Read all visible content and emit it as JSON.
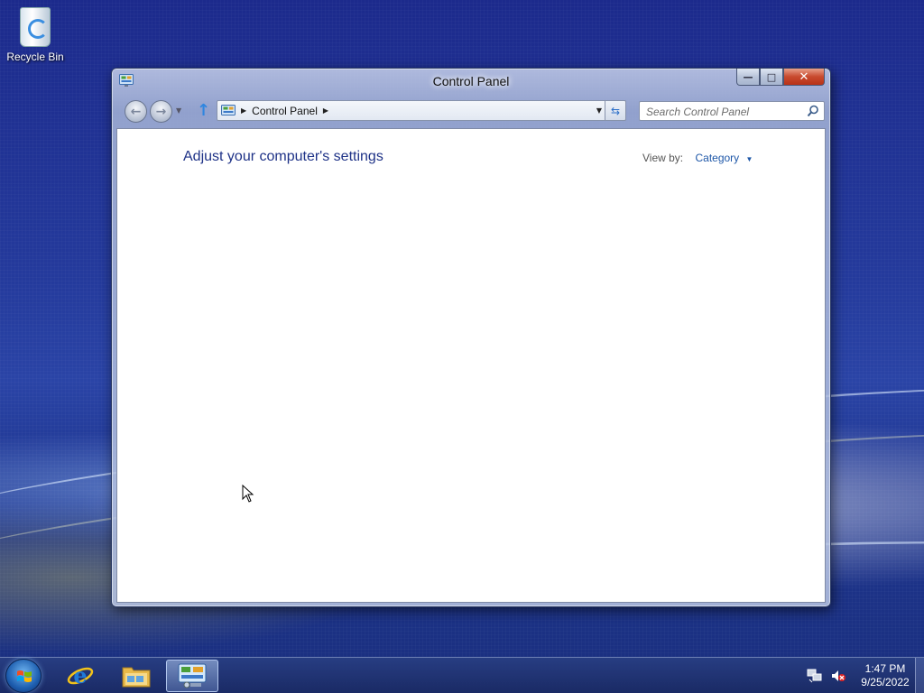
{
  "desktop": {
    "icons": [
      {
        "label": "Recycle Bin",
        "icon": "recycle-bin-icon"
      }
    ]
  },
  "window": {
    "title": "Control Panel",
    "controls": {
      "minimize": "minimize-icon",
      "maximize": "maximize-icon",
      "close": "close-icon"
    },
    "nav": {
      "breadcrumb": [
        "Control Panel"
      ],
      "search_placeholder": "Search Control Panel"
    },
    "content": {
      "heading": "Adjust your computer's settings",
      "view_by_label": "View by:",
      "view_by_value": "Category"
    }
  },
  "taskbar": {
    "pinned": [
      {
        "name": "internet-explorer",
        "icon": "ie-icon"
      },
      {
        "name": "windows-explorer",
        "icon": "folder-icon"
      },
      {
        "name": "control-panel",
        "icon": "control-panel-icon",
        "active": true
      }
    ],
    "clock": {
      "time": "1:47 PM",
      "date": "9/25/2022"
    }
  },
  "colors": {
    "desktop_bg": "#243a9c",
    "heading": "#1e3287",
    "link": "#1e57a8",
    "close_button": "#c84a2e"
  }
}
